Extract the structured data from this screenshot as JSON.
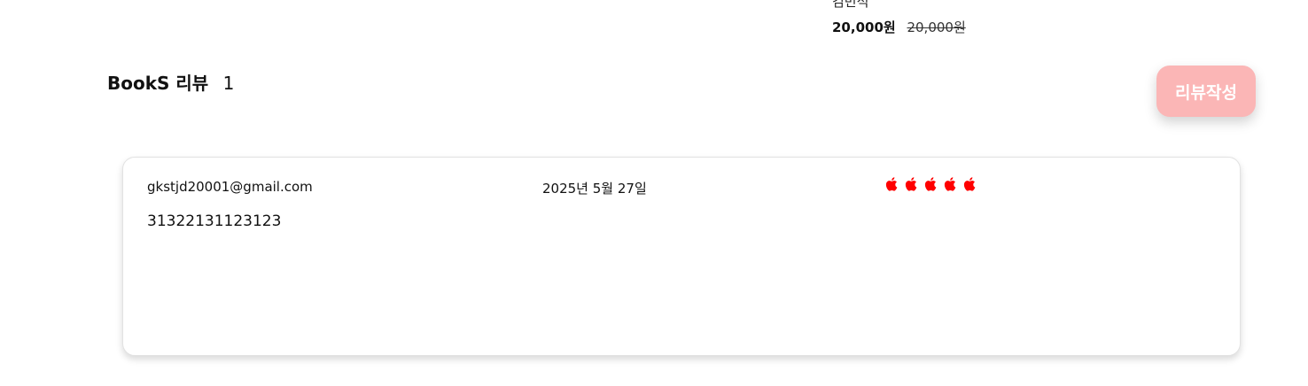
{
  "product": {
    "author": "김민석",
    "sale_price": "20,000원",
    "original_price": "20,000원"
  },
  "reviews": {
    "title": "BookS 리뷰",
    "count": "1",
    "write_button_label": "리뷰작성",
    "items": [
      {
        "email": "gkstjd20001@gmail.com",
        "date": "2025년 5월 27일",
        "rating": 5,
        "rating_icon": "apple-icon",
        "rating_color": "#ff0000",
        "content": "31322131123123"
      }
    ]
  },
  "colors": {
    "write_button_bg": "#fbb6b6",
    "rating_icon": "#ff0000"
  }
}
